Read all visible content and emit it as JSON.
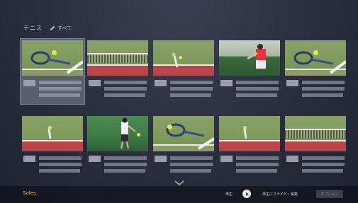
{
  "header": {
    "title": "テニス",
    "subtitle": "すべて"
  },
  "footer": {
    "left_label": "Sales",
    "hint_play": "再生",
    "hint_options": "再生にスライド・編集",
    "action_label": "オプション"
  },
  "tiles": [
    {
      "scene": "racket-ball"
    },
    {
      "scene": "net"
    },
    {
      "scene": "court-ball"
    },
    {
      "scene": "player-red"
    },
    {
      "scene": "racket-ball"
    },
    {
      "scene": "court-ball"
    },
    {
      "scene": "player-white"
    },
    {
      "scene": "racket-ball"
    },
    {
      "scene": "court-ball"
    },
    {
      "scene": "net"
    }
  ],
  "colors": {
    "accent": "#e8c14a",
    "court_band": "#b8464a",
    "grass": "#7f9a5c"
  }
}
